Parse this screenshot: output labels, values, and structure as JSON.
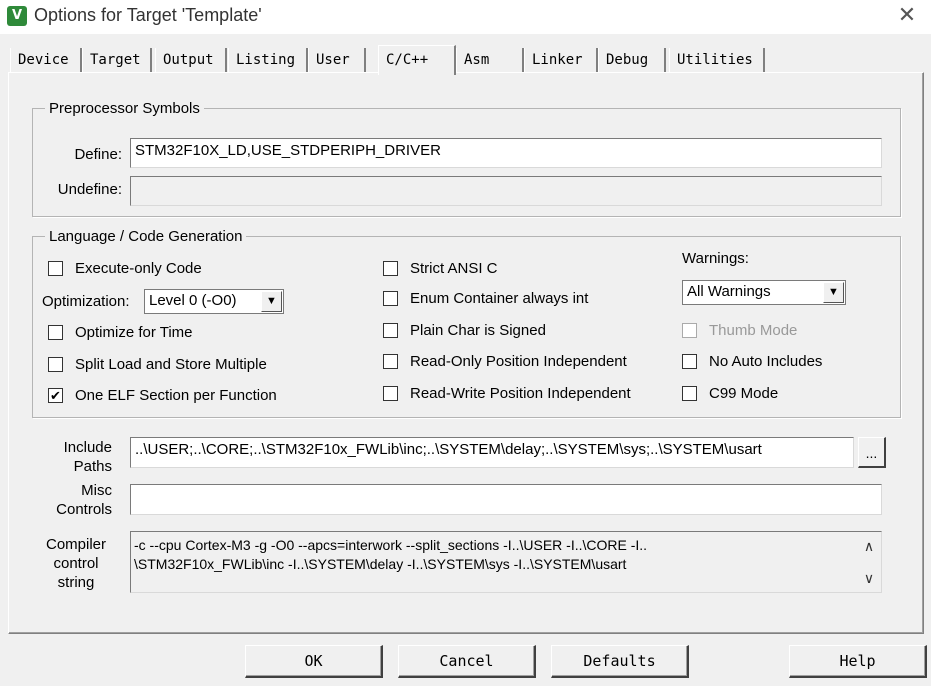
{
  "window": {
    "title": "Options for Target 'Template'",
    "icon_label": "V",
    "close_glyph": "✕"
  },
  "tabs": [
    "Device",
    "Target",
    "Output",
    "Listing",
    "User",
    "C/C++",
    "Asm",
    "Linker",
    "Debug",
    "Utilities"
  ],
  "active_tab": "C/C++",
  "preprocessor": {
    "legend": "Preprocessor Symbols",
    "define_label": "Define:",
    "define_value": "STM32F10X_LD,USE_STDPERIPH_DRIVER",
    "undefine_label": "Undefine:",
    "undefine_value": ""
  },
  "language": {
    "legend": "Language / Code Generation",
    "execute_only": {
      "label": "Execute-only Code",
      "checked": false
    },
    "optimization_label": "Optimization:",
    "optimization_value": "Level 0 (-O0)",
    "optimize_time": {
      "label": "Optimize for Time",
      "checked": false
    },
    "split_load": {
      "label": "Split Load and Store Multiple",
      "checked": false
    },
    "one_elf": {
      "label": "One ELF Section per Function",
      "checked": true
    },
    "strict_ansi": {
      "label": "Strict ANSI C",
      "checked": false
    },
    "enum_container": {
      "label": "Enum Container always int",
      "checked": false
    },
    "plain_char": {
      "label": "Plain Char is Signed",
      "checked": false
    },
    "ro_pi": {
      "label": "Read-Only Position Independent",
      "checked": false
    },
    "rw_pi": {
      "label": "Read-Write Position Independent",
      "checked": false
    },
    "warnings_label": "Warnings:",
    "warnings_value": "All Warnings",
    "thumb_mode": {
      "label": "Thumb Mode",
      "checked": false,
      "disabled": true
    },
    "no_auto_includes": {
      "label": "No Auto Includes",
      "checked": false
    },
    "c99_mode": {
      "label": "C99 Mode",
      "checked": false
    }
  },
  "include_paths": {
    "label_line1": "Include",
    "label_line2": "Paths",
    "value": "..\\USER;..\\CORE;..\\STM32F10x_FWLib\\inc;..\\SYSTEM\\delay;..\\SYSTEM\\sys;..\\SYSTEM\\usart",
    "browse_label": "..."
  },
  "misc_controls": {
    "label_line1": "Misc",
    "label_line2": "Controls",
    "value": ""
  },
  "compiler_string": {
    "label_line1": "Compiler",
    "label_line2": "control",
    "label_line3": "string",
    "line1": "-c --cpu Cortex-M3 -g -O0 --apcs=interwork --split_sections -I..\\USER -I..\\CORE -I..",
    "line2": "\\STM32F10x_FWLib\\inc -I..\\SYSTEM\\delay -I..\\SYSTEM\\sys -I..\\SYSTEM\\usart"
  },
  "buttons": {
    "ok": "OK",
    "cancel": "Cancel",
    "defaults": "Defaults",
    "help": "Help"
  },
  "icons": {
    "check": "✔",
    "dropdown": "▼",
    "scroll_up": "∧",
    "scroll_down": "∨"
  }
}
